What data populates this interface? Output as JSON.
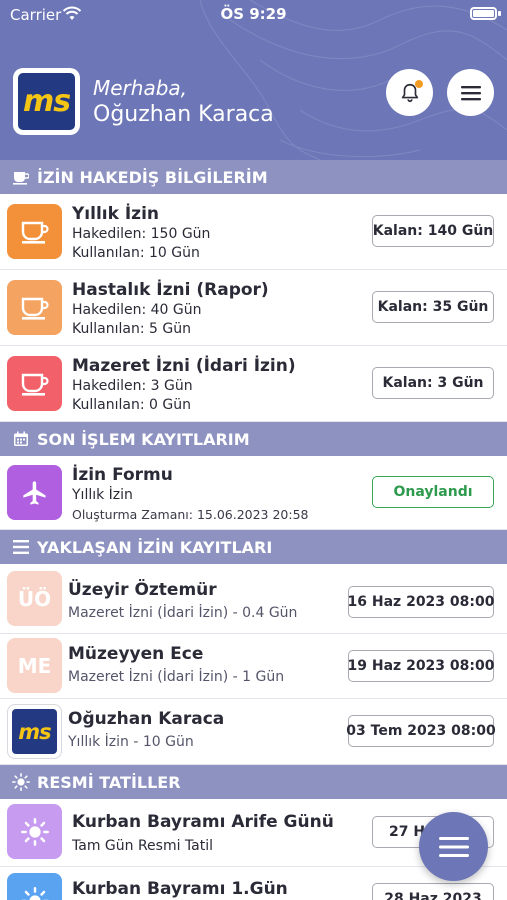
{
  "status_bar": {
    "carrier": "Carrier",
    "time": "ÖS 9:29"
  },
  "header": {
    "logo_text": "ms",
    "greeting": "Merhaba,",
    "user_name": "Oğuzhan Karaca"
  },
  "sections": {
    "leave_rights": "İZİN HAKEDİŞ BİLGİLERİM",
    "recent_transactions": "SON İŞLEM KAYITLARIM",
    "upcoming_leaves": "YAKLAŞAN İZİN KAYITLARI",
    "public_holidays": "RESMİ TATİLLER"
  },
  "leave_rights": [
    {
      "title": "Yıllık İzin",
      "earned": "Hakedilen: 150 Gün",
      "used": "Kullanılan: 10 Gün",
      "remaining": "Kalan: 140 Gün",
      "color": "#f3913a",
      "icon": "cup-icon"
    },
    {
      "title": "Hastalık İzni (Rapor)",
      "earned": "Hakedilen: 40 Gün",
      "used": "Kullanılan: 5 Gün",
      "remaining": "Kalan: 35 Gün",
      "color": "#f4a361",
      "icon": "cup-icon"
    },
    {
      "title": "Mazeret İzni (İdari İzin)",
      "earned": "Hakedilen: 3 Gün",
      "used": "Kullanılan: 0 Gün",
      "remaining": "Kalan: 3 Gün",
      "color": "#f2616a",
      "icon": "cup-icon"
    }
  ],
  "recent_transactions": [
    {
      "title": "İzin Formu",
      "subtitle": "Yıllık İzin",
      "created": "Oluşturma Zamanı: 15.06.2023 20:58",
      "status": "Onaylandı",
      "status_color": "#3aa55a",
      "color": "#b05fe0",
      "icon": "airplane-icon"
    }
  ],
  "upcoming_leaves": [
    {
      "initials": "ÜÖ",
      "name": "Üzeyir Öztemür",
      "detail": "Mazeret İzni (İdari İzin)  - 0.4 Gün",
      "date": "16 Haz 2023 08:00",
      "avatar_color": "#f8d5c8"
    },
    {
      "initials": "ME",
      "name": "Müzeyyen Ece",
      "detail": "Mazeret İzni (İdari İzin)  - 1 Gün",
      "date": "19 Haz 2023 08:00",
      "avatar_color": "#f8d5c8"
    },
    {
      "initials": "ms",
      "name": "Oğuzhan Karaca",
      "detail": "Yıllık İzin  - 10 Gün",
      "date": "03 Tem 2023 08:00",
      "avatar_color": "#233a82"
    }
  ],
  "public_holidays": [
    {
      "title": "Kurban Bayramı Arife Günü",
      "subtitle": "Tam Gün Resmi Tatil",
      "date": "27 H",
      "color": "#c79cf0",
      "icon": "sun-icon"
    },
    {
      "title": "Kurban Bayramı 1.Gün",
      "subtitle": "",
      "date": "28 Haz 2023",
      "color": "#5aa3f0",
      "icon": "sun-icon"
    }
  ],
  "colors": {
    "header": "#6d76b6",
    "section": "#8d92c1",
    "logo_bg": "#233a82",
    "logo_text": "#f4c515"
  }
}
